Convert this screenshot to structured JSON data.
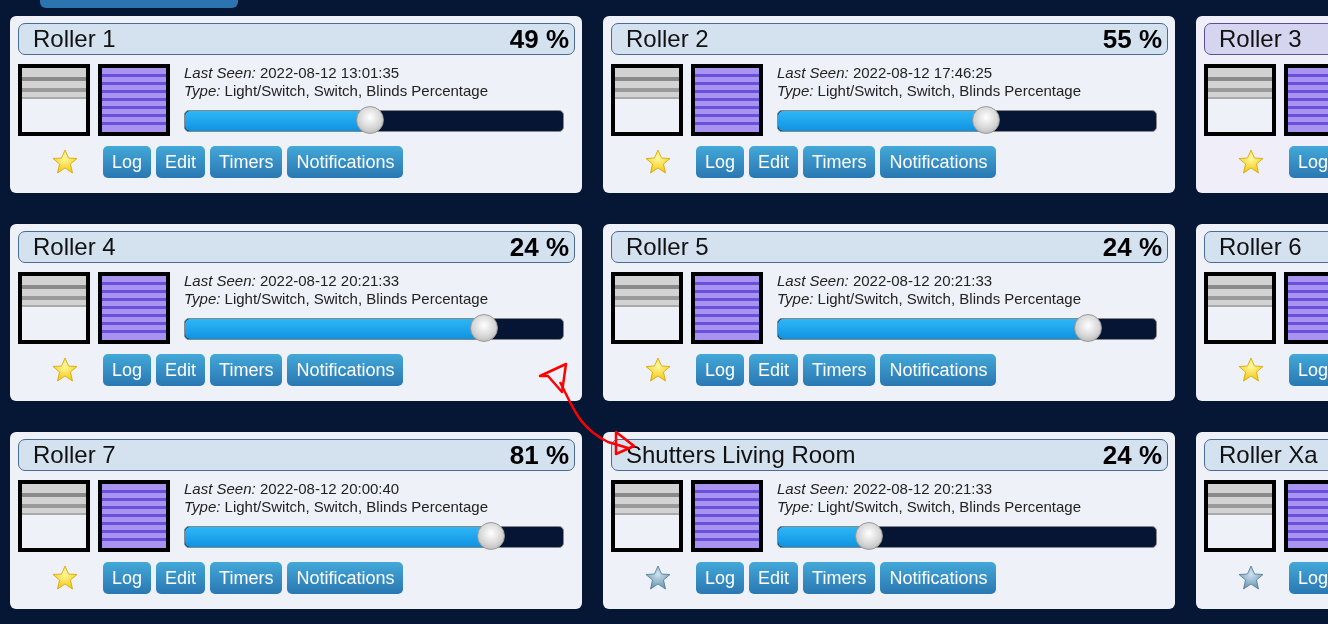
{
  "devices": [
    {
      "name": "Roller 1",
      "percent": "49 %",
      "last_seen_label": "Last Seen:",
      "last_seen": "2022-08-12 13:01:35",
      "type_label": "Type:",
      "type": "Light/Switch, Switch, Blinds Percentage",
      "level": 0.49,
      "favorite": true,
      "highlighted": false,
      "buttons": [
        "Log",
        "Edit",
        "Timers",
        "Notifications"
      ]
    },
    {
      "name": "Roller 2",
      "percent": "55 %",
      "last_seen_label": "Last Seen:",
      "last_seen": "2022-08-12 17:46:25",
      "type_label": "Type:",
      "type": "Light/Switch, Switch, Blinds Percentage",
      "level": 0.55,
      "favorite": true,
      "highlighted": false,
      "buttons": [
        "Log",
        "Edit",
        "Timers",
        "Notifications"
      ]
    },
    {
      "name": "Roller 3",
      "favorite": true,
      "highlighted": true,
      "buttons": [
        "Log"
      ]
    },
    {
      "name": "Roller 4",
      "percent": "24 %",
      "last_seen_label": "Last Seen:",
      "last_seen": "2022-08-12 20:21:33",
      "type_label": "Type:",
      "type": "Light/Switch, Switch, Blinds Percentage",
      "level": 0.79,
      "favorite": true,
      "highlighted": false,
      "buttons": [
        "Log",
        "Edit",
        "Timers",
        "Notifications"
      ]
    },
    {
      "name": "Roller 5",
      "percent": "24 %",
      "last_seen_label": "Last Seen:",
      "last_seen": "2022-08-12 20:21:33",
      "type_label": "Type:",
      "type": "Light/Switch, Switch, Blinds Percentage",
      "level": 0.82,
      "favorite": true,
      "highlighted": false,
      "buttons": [
        "Log",
        "Edit",
        "Timers",
        "Notifications"
      ]
    },
    {
      "name": "Roller 6",
      "favorite": true,
      "highlighted": false,
      "buttons": [
        "Log"
      ]
    },
    {
      "name": "Roller 7",
      "percent": "81 %",
      "last_seen_label": "Last Seen:",
      "last_seen": "2022-08-12 20:00:40",
      "type_label": "Type:",
      "type": "Light/Switch, Switch, Blinds Percentage",
      "level": 0.81,
      "favorite": true,
      "highlighted": false,
      "buttons": [
        "Log",
        "Edit",
        "Timers",
        "Notifications"
      ]
    },
    {
      "name": "Shutters Living Room",
      "percent": "24 %",
      "last_seen_label": "Last Seen:",
      "last_seen": "2022-08-12 20:21:33",
      "type_label": "Type:",
      "type": "Light/Switch, Switch, Blinds Percentage",
      "level": 0.24,
      "favorite": false,
      "highlighted": false,
      "buttons": [
        "Log",
        "Edit",
        "Timers",
        "Notifications"
      ]
    },
    {
      "name": "Roller Xa",
      "favorite": false,
      "highlighted": false,
      "buttons": [
        "Log"
      ]
    }
  ]
}
